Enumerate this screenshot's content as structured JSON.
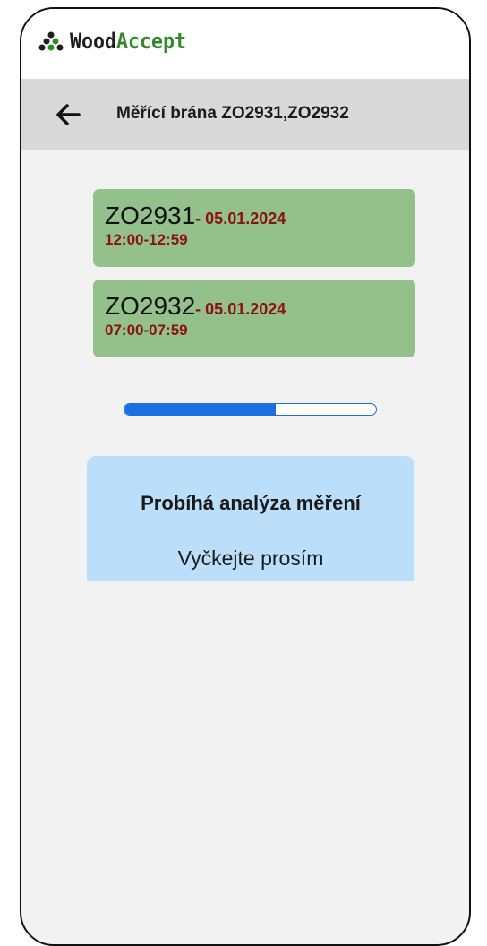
{
  "brand": {
    "name_part1": "Wood",
    "name_part2": "Accept",
    "color_dark": "#1d1d1d",
    "color_green": "#2f8a2a"
  },
  "header": {
    "back_icon": "arrow-left-icon",
    "title": "Měřící brána ZO2931,ZO2932"
  },
  "gates": [
    {
      "id": "ZO2931",
      "date": "- 05.01.2024",
      "time": "12:00-12:59"
    },
    {
      "id": "ZO2932",
      "date": "- 05.01.2024",
      "time": "07:00-07:59"
    }
  ],
  "progress": {
    "fraction": 0.6,
    "color": "#1c6fe0"
  },
  "analysis": {
    "title": "Probíhá analýza měření",
    "subtitle": "Vyčkejte prosím"
  },
  "colors": {
    "card_bg": "#93c08b",
    "date_red": "#8b1212",
    "analysis_bg": "#bbdefb",
    "header_bg": "#d9d9d9"
  }
}
